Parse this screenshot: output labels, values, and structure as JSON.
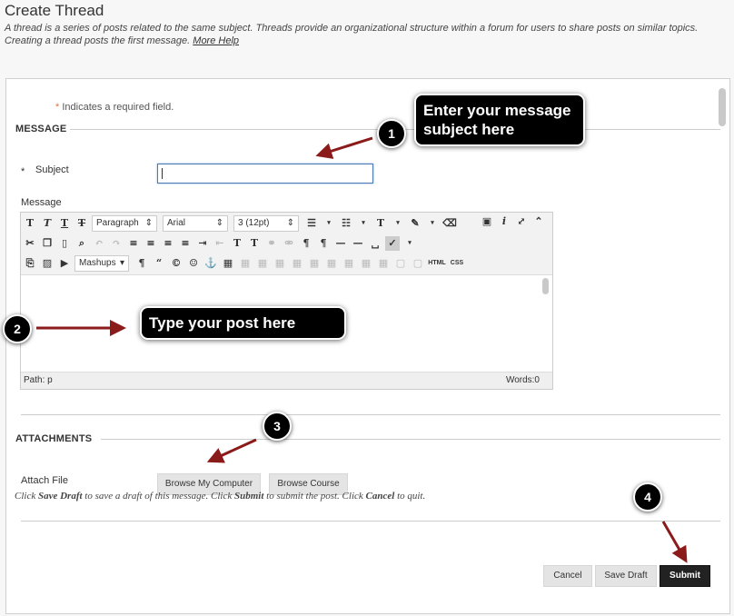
{
  "page": {
    "title": "Create Thread",
    "description": "A thread is a series of posts related to the same subject. Threads provide an organizational structure within a forum for users to share posts on similar topics. Creating a thread posts the first message.",
    "more_help": "More Help"
  },
  "form": {
    "required_note": "Indicates a required field.",
    "required_marker": "*",
    "message_section": "MESSAGE",
    "subject_label": "Subject",
    "subject_value": "",
    "message_label": "Message",
    "attachments_section": "ATTACHMENTS",
    "attach_file_label": "Attach File"
  },
  "editor": {
    "paragraph": "Paragraph",
    "font": "Arial",
    "size": "3 (12pt)",
    "mashups": "Mashups",
    "html": "HTML",
    "css": "CSS",
    "path": "Path: p",
    "words": "Words:0"
  },
  "buttons": {
    "browse_computer": "Browse My Computer",
    "browse_course": "Browse Course",
    "cancel": "Cancel",
    "save_draft": "Save Draft",
    "submit": "Submit"
  },
  "footer_note": {
    "p1": "Click ",
    "save_draft": "Save Draft",
    "p2": " to save a draft of this message. Click ",
    "submit": "Submit",
    "p3": " to submit the post. Click ",
    "cancel": "Cancel",
    "p4": " to quit."
  },
  "callouts": {
    "one_number": "1",
    "one_text": "Enter your message subject here",
    "two_number": "2",
    "two_text": "Type your post here",
    "three_number": "3",
    "four_number": "4"
  },
  "colors": {
    "arrow": "#8b1a1a",
    "required_star": "#e0733c",
    "submit_bg": "#222222"
  }
}
